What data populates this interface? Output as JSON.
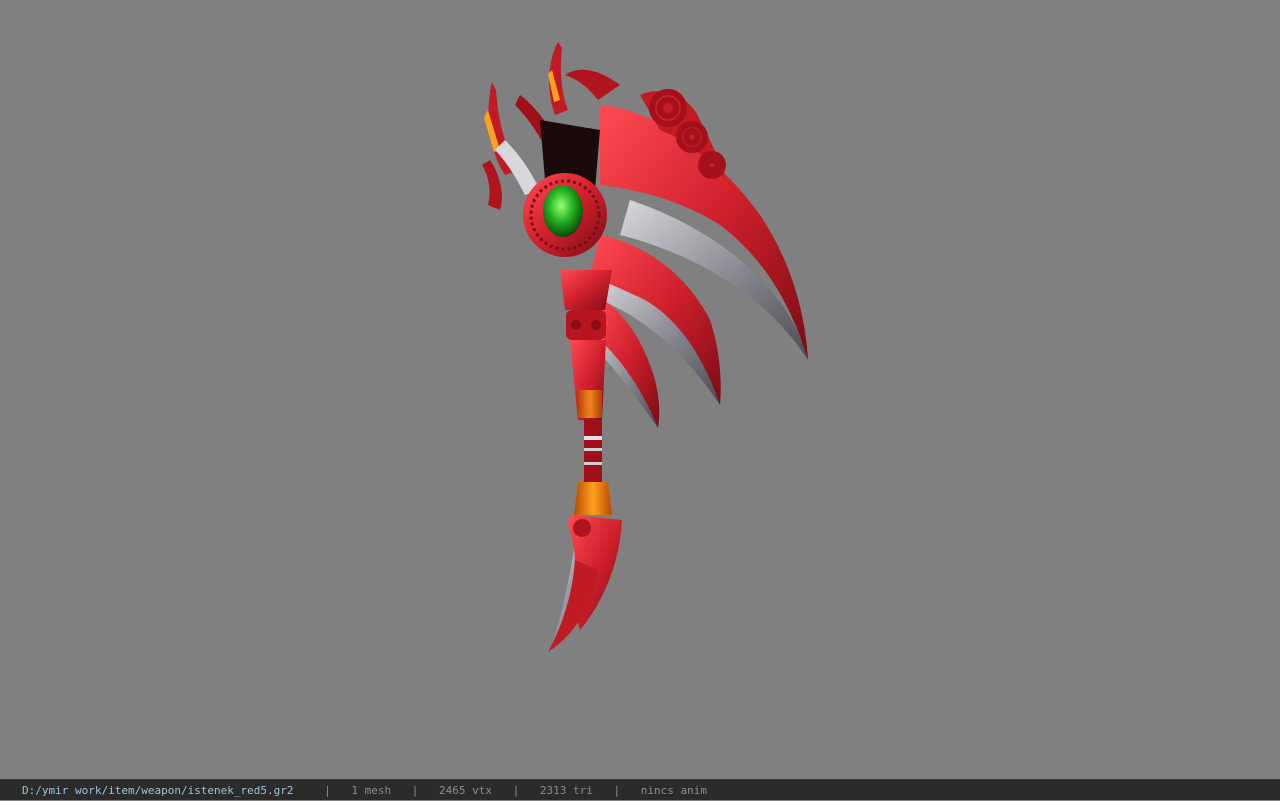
{
  "viewer": {
    "background_color": "#808080",
    "model": {
      "name": "red scythe weapon model",
      "main_color": "#c8202a",
      "gem_color": "#22b422",
      "blade_color": "#8e8e96"
    }
  },
  "status_bar": {
    "file_path": "D:/ymir work/item/weapon/istenek_red5.gr2",
    "separator": "|",
    "mesh_count": "1 mesh",
    "vertex_count": "2465 vtx",
    "triangle_count": "2313 tri",
    "animation": "nincs anim"
  }
}
